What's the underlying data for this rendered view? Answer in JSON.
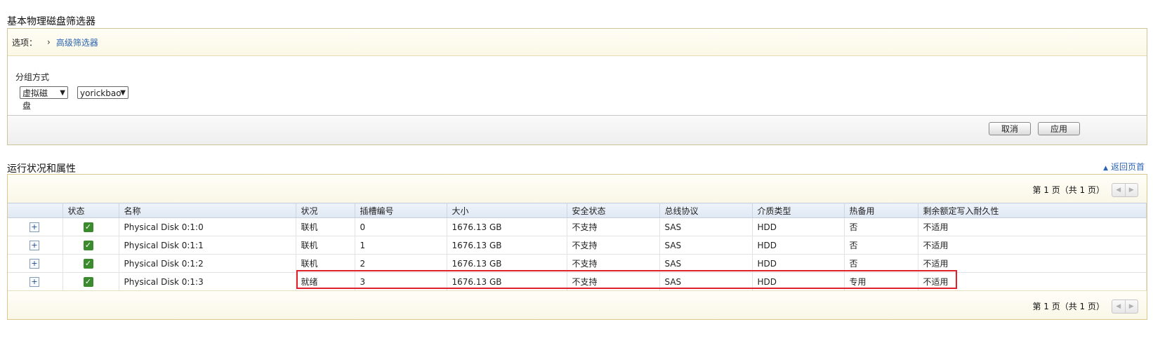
{
  "filter": {
    "title": "基本物理磁盘筛选器",
    "options_label": "选项：",
    "advanced_link": "高级筛选器",
    "group_by_label": "分组方式",
    "group_by_select": "虚拟磁盘",
    "vdisk_select": "yorickbao",
    "cancel_label": "取消",
    "apply_label": "应用"
  },
  "results": {
    "title": "运行状况和属性",
    "back_link": "返回页首",
    "pager_text": "第 1 页（共 1 页）",
    "columns": [
      "",
      "状态",
      "名称",
      "状况",
      "插槽编号",
      "大小",
      "安全状态",
      "总线协议",
      "介质类型",
      "热备用",
      "剩余额定写入耐久性"
    ],
    "rows": [
      {
        "name": "Physical Disk 0:1:0",
        "state": "联机",
        "slot": "0",
        "size": "1676.13 GB",
        "security": "不支持",
        "bus": "SAS",
        "media": "HDD",
        "hotspare": "否",
        "endurance": "不适用"
      },
      {
        "name": "Physical Disk 0:1:1",
        "state": "联机",
        "slot": "1",
        "size": "1676.13 GB",
        "security": "不支持",
        "bus": "SAS",
        "media": "HDD",
        "hotspare": "否",
        "endurance": "不适用"
      },
      {
        "name": "Physical Disk 0:1:2",
        "state": "联机",
        "slot": "2",
        "size": "1676.13 GB",
        "security": "不支持",
        "bus": "SAS",
        "media": "HDD",
        "hotspare": "否",
        "endurance": "不适用"
      },
      {
        "name": "Physical Disk 0:1:3",
        "state": "就绪",
        "slot": "3",
        "size": "1676.13 GB",
        "security": "不支持",
        "bus": "SAS",
        "media": "HDD",
        "hotspare": "专用",
        "endurance": "不适用"
      }
    ]
  },
  "icons": {
    "expand": "plus-icon",
    "status": "check-icon",
    "options_chevron": "chevron-right-icon",
    "back_to_top": "triangle-up-icon"
  },
  "colors": {
    "link": "#2c64b3",
    "status_ok": "#3b8a2e",
    "highlight": "#e0202a"
  }
}
